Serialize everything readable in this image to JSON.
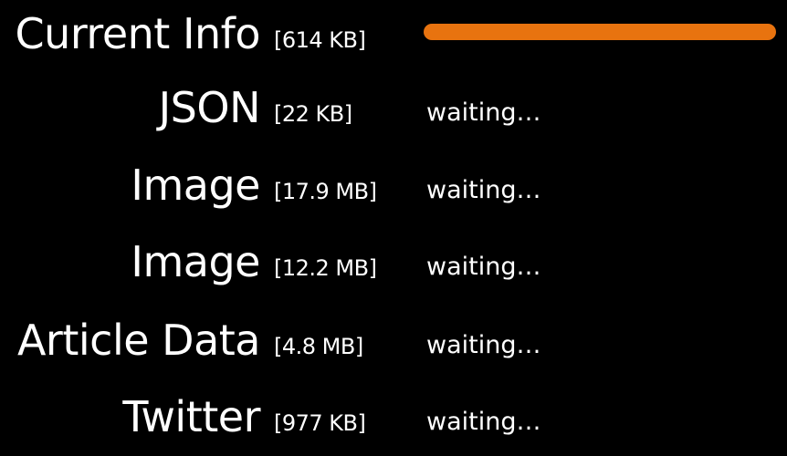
{
  "accent_color": "#e8730f",
  "rows": [
    {
      "name": "Current Info",
      "size": "[614 KB]",
      "status": "",
      "progress": 1.0
    },
    {
      "name": "JSON",
      "size": "[22 KB]",
      "status": "waiting…"
    },
    {
      "name": "Image",
      "size": "[17.9 MB]",
      "status": "waiting…"
    },
    {
      "name": "Image",
      "size": "[12.2 MB]",
      "status": "waiting…"
    },
    {
      "name": "Article Data",
      "size": "[4.8 MB]",
      "status": "waiting…"
    },
    {
      "name": "Twitter",
      "size": "[977 KB]",
      "status": "waiting…"
    }
  ]
}
